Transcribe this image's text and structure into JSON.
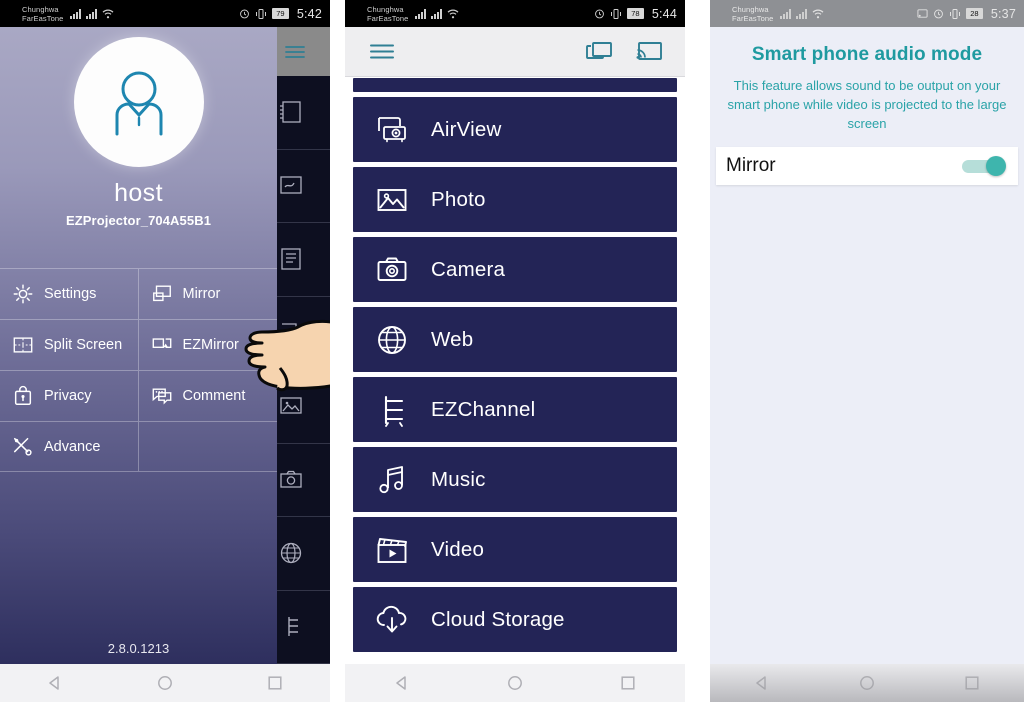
{
  "panels": {
    "sidebar": {
      "statusbar": {
        "carrier_line1": "Chunghwa",
        "carrier_line2": "FarEasTone",
        "battery": "79",
        "time": "5:42"
      },
      "avatar_icon": "person-avatar-icon",
      "host_name": "host",
      "device_id": "EZProjector_704A55B1",
      "menu": [
        {
          "label": "Settings",
          "icon": "gear-icon"
        },
        {
          "label": "Mirror",
          "icon": "mirror-screen-icon"
        },
        {
          "label": "Split Screen",
          "icon": "split-screen-icon"
        },
        {
          "label": "EZMirror",
          "icon": "ezmirror-icon"
        },
        {
          "label": "Privacy",
          "icon": "lock-bag-icon"
        },
        {
          "label": "Comment",
          "icon": "comment-bubble-icon"
        },
        {
          "label": "Advance",
          "icon": "tools-icon"
        },
        {
          "label": "",
          "icon": "none"
        }
      ],
      "version": "2.8.0.1213",
      "background_list": [
        {
          "icon": "note-icon"
        },
        {
          "icon": "whiteboard-icon"
        },
        {
          "icon": "document-icon"
        },
        {
          "icon": "airview-icon"
        },
        {
          "icon": "photo-icon"
        },
        {
          "icon": "camera-icon"
        },
        {
          "icon": "web-globe-icon"
        },
        {
          "icon": "ezchannel-icon"
        }
      ],
      "cursor": "pointing-hand-cursor",
      "navbar": [
        "back-icon",
        "home-icon",
        "recents-icon"
      ]
    },
    "menu_list": {
      "statusbar": {
        "carrier_line1": "Chunghwa",
        "carrier_line2": "FarEasTone",
        "battery": "78",
        "time": "5:44"
      },
      "toolbar": {
        "hamburger": "hamburger-menu-icon",
        "split_icon": "split-window-icon",
        "cast_icon": "cast-screen-icon"
      },
      "items": [
        {
          "label": "AirView",
          "icon": "airview-icon"
        },
        {
          "label": "Photo",
          "icon": "photo-icon"
        },
        {
          "label": "Camera",
          "icon": "camera-icon"
        },
        {
          "label": "Web",
          "icon": "web-globe-icon"
        },
        {
          "label": "EZChannel",
          "icon": "ezchannel-icon"
        },
        {
          "label": "Music",
          "icon": "music-note-icon"
        },
        {
          "label": "Video",
          "icon": "video-clapper-icon"
        },
        {
          "label": "Cloud Storage",
          "icon": "cloud-download-icon"
        }
      ],
      "navbar": [
        "back-icon",
        "home-icon",
        "recents-icon"
      ]
    },
    "audio_mode": {
      "statusbar": {
        "carrier_line1": "Chunghwa",
        "carrier_line2": "FarEasTone",
        "battery": "28",
        "time": "5:37"
      },
      "title": "Smart phone audio mode",
      "description": "This feature allows sound to be output on your smart phone while video is projected to the large screen",
      "setting_label": "Mirror",
      "setting_state": "on",
      "navbar": [
        "back-icon",
        "home-icon",
        "recents-icon"
      ]
    }
  },
  "colors": {
    "list_navy": "#232456",
    "teal_accent": "#3eb5ad",
    "title_teal": "#1f9aa0",
    "drawer_top": "#a9a8c4",
    "drawer_bottom": "#2e2f5e",
    "status_dark": "#000000",
    "status_gray": "#8e9094"
  }
}
